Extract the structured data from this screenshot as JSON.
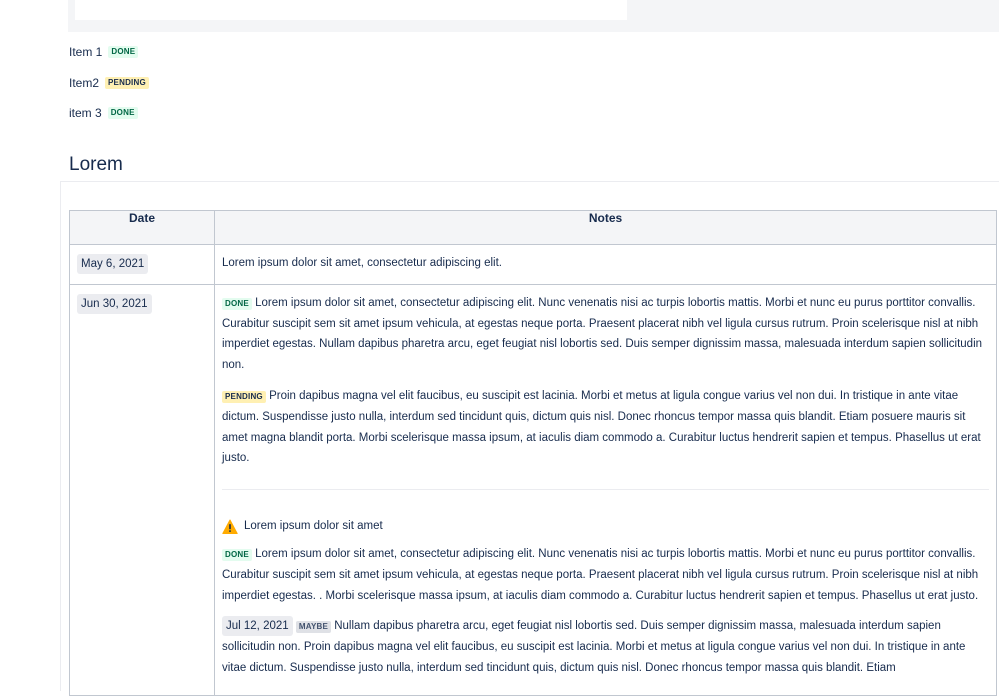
{
  "tasks": [
    {
      "label": "Item 1",
      "status": "DONE",
      "status_kind": "done"
    },
    {
      "label": "Item2",
      "status": "PENDING",
      "status_kind": "pending"
    },
    {
      "label": "item 3",
      "status": "DONE",
      "status_kind": "done"
    }
  ],
  "section": {
    "title": "Lorem"
  },
  "table": {
    "headers": {
      "date": "Date",
      "notes": "Notes"
    },
    "rows": [
      {
        "date": "May 6, 2021",
        "text": "Lorem ipsum dolor sit amet, consectetur adipiscing elit."
      },
      {
        "date": "Jun 30, 2021",
        "para1_status": "DONE",
        "para1_text": "Lorem ipsum dolor sit amet, consectetur adipiscing elit. Nunc venenatis nisi ac turpis lobortis mattis. Morbi et nunc eu purus porttitor convallis. Curabitur suscipit sem sit amet ipsum vehicula, at egestas neque porta. Praesent placerat nibh vel ligula cursus rutrum. Proin scelerisque nisl at nibh imperdiet egestas. Nullam dapibus pharetra arcu, eget feugiat nisl lobortis sed. Duis semper dignissim massa, malesuada interdum sapien sollicitudin non.",
        "para2_status": "PENDING",
        "para2_text": "Proin dapibus magna vel elit faucibus, eu suscipit est lacinia. Morbi et metus at ligula congue varius vel non dui. In tristique in ante vitae dictum. Suspendisse justo nulla, interdum sed tincidunt quis, dictum quis nisl. Donec rhoncus tempor massa quis blandit. Etiam posuere mauris sit amet magna blandit porta. Morbi scelerisque massa ipsum, at iaculis diam commodo a. Curabitur luctus hendrerit sapien et tempus. Phasellus ut erat justo.",
        "warning_text": "Lorem ipsum dolor sit amet",
        "para3_status": "DONE",
        "para3_text": "Lorem ipsum dolor sit amet, consectetur adipiscing elit. Nunc venenatis nisi ac turpis lobortis mattis. Morbi et nunc eu purus porttitor convallis. Curabitur suscipit sem sit amet ipsum vehicula, at egestas neque porta. Praesent placerat nibh vel ligula cursus rutrum. Proin scelerisque nisl at nibh imperdiet egestas. . Morbi scelerisque massa ipsum, at iaculis diam commodo a. Curabitur luctus hendrerit sapien et tempus. Phasellus ut erat justo.",
        "para4_date": "Jul 12, 2021",
        "para4_status": "MAYBE",
        "para4_text": "Nullam dapibus pharetra arcu, eget feugiat nisl lobortis sed. Duis semper dignissim massa, malesuada interdum sapien sollicitudin non. Proin dapibus magna vel elit faucibus, eu suscipit est lacinia. Morbi et metus at ligula congue varius vel non dui. In tristique in ante vitae dictum. Suspendisse justo nulla, interdum sed tincidunt quis, dictum quis nisl. Donec rhoncus tempor massa quis blandit. Etiam"
      }
    ]
  },
  "icons": {
    "warning": "warning-icon"
  },
  "colors": {
    "done_bg": "#e3fcef",
    "done_fg": "#006644",
    "pending_bg": "#fff0b3",
    "maybe_bg": "#dfe1e6",
    "warning": "#ffab00",
    "text": "#172b4d"
  }
}
